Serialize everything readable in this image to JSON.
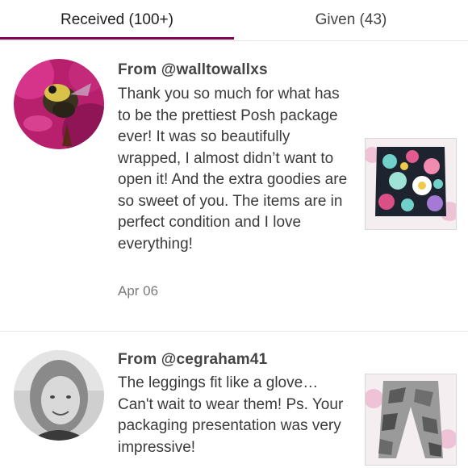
{
  "tabs": {
    "received_label": "Received (100+)",
    "given_label": "Given (43)",
    "accent": "#7f0353"
  },
  "reviews": [
    {
      "from": "From @walltowallxs",
      "text": "Thank you so much for what has to be the prettiest Posh package ever! It was so beautifully wrapped, I almost didn’t want to open it! And the extra goodies are so sweet of you. The items are in perfect condition and I love everything!",
      "date": "Apr 06",
      "avatar_icon": "bee-on-flower-photo",
      "thumbnail_icon": "floral-skirt-photo"
    },
    {
      "from": "From @cegraham41",
      "text": "The leggings fit like a glove… Can't wait to wear them!  Ps. Your packaging presentation was very impressive!",
      "avatar_icon": "woman-portrait-photo",
      "thumbnail_icon": "camo-leggings-photo"
    }
  ]
}
